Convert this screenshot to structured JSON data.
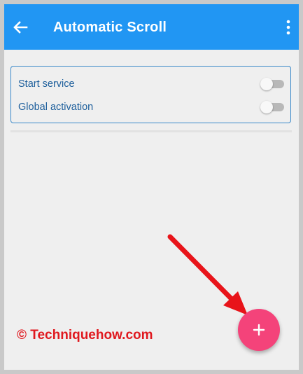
{
  "appbar": {
    "title": "Automatic Scroll",
    "back_icon": "arrow-back-icon",
    "menu_icon": "more-vert-icon"
  },
  "settings": {
    "items": [
      {
        "label": "Start service",
        "enabled": false
      },
      {
        "label": "Global activation",
        "enabled": false
      }
    ]
  },
  "watermark": "© Techniquehow.com",
  "fab": {
    "icon": "plus-icon"
  },
  "colors": {
    "primary": "#2196f3",
    "accent": "#f4437a",
    "label_text": "#1e5f9c",
    "watermark": "#e0191f",
    "annotation_arrow": "#e8141a"
  }
}
